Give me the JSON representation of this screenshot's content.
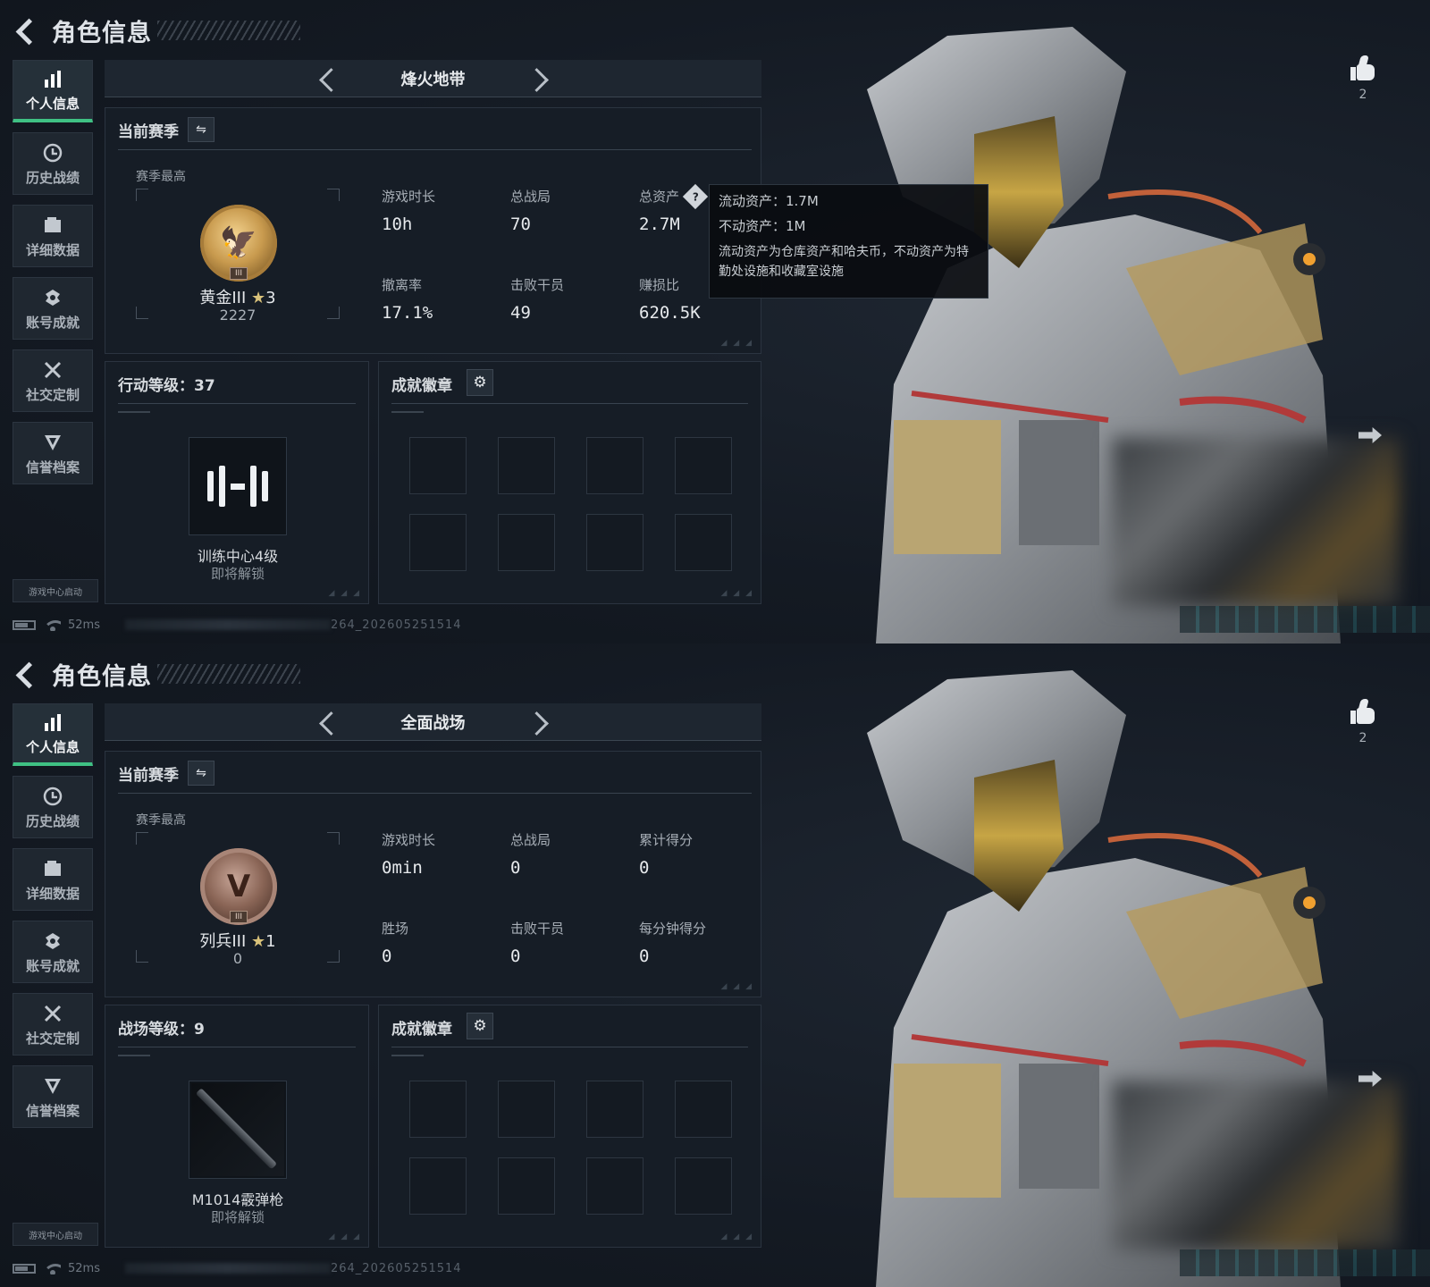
{
  "colors": {
    "accent": "#3fc184",
    "bg": "#141a23",
    "panel": "#161d26",
    "gold": "#c89a4e"
  },
  "screens": [
    {
      "header": {
        "title": "角色信息"
      },
      "sidebar": [
        {
          "label": "个人信息",
          "icon": "bar-chart-icon",
          "active": true
        },
        {
          "label": "历史战绩",
          "icon": "clock-icon"
        },
        {
          "label": "详细数据",
          "icon": "folder-icon"
        },
        {
          "label": "账号成就",
          "icon": "trophy-icon"
        },
        {
          "label": "社交定制",
          "icon": "tools-icon"
        },
        {
          "label": "信誉档案",
          "icon": "shield-icon"
        }
      ],
      "launch": "游戏中心启动",
      "status": {
        "ping": "52ms",
        "build": "264_202605251514"
      },
      "mode": "烽火地带",
      "season": {
        "title": "当前赛季",
        "best_label": "赛季最高",
        "rank_name": "黄金III",
        "rank_stars": "3",
        "rank_score": "2227",
        "badge_tier": "III",
        "stats": [
          {
            "label": "游戏时长",
            "value": "10h"
          },
          {
            "label": "总战局",
            "value": "70"
          },
          {
            "label": "总资产",
            "value": "2.7M"
          },
          {
            "label": "撤离率",
            "value": "17.1%"
          },
          {
            "label": "击败干员",
            "value": "49"
          },
          {
            "label": "赚损比",
            "value": "620.5K"
          }
        ]
      },
      "tooltip": {
        "liquid": "流动资产：1.7M",
        "fixed": "不动资产：1M",
        "desc": "流动资产为仓库资产和哈夫币，不动资产为特勤处设施和收藏室设施"
      },
      "level": {
        "title": "行动等级：37",
        "unlock_name": "训练中心4级",
        "unlock_sub": "即将解锁"
      },
      "achievements": {
        "title": "成就徽章"
      },
      "likes": "2"
    },
    {
      "header": {
        "title": "角色信息"
      },
      "sidebar": [
        {
          "label": "个人信息",
          "icon": "bar-chart-icon",
          "active": true
        },
        {
          "label": "历史战绩",
          "icon": "clock-icon"
        },
        {
          "label": "详细数据",
          "icon": "folder-icon"
        },
        {
          "label": "账号成就",
          "icon": "trophy-icon"
        },
        {
          "label": "社交定制",
          "icon": "tools-icon"
        },
        {
          "label": "信誉档案",
          "icon": "shield-icon"
        }
      ],
      "launch": "游戏中心启动",
      "status": {
        "ping": "52ms",
        "build": "264_202605251514"
      },
      "mode": "全面战场",
      "season": {
        "title": "当前赛季",
        "best_label": "赛季最高",
        "rank_name": "列兵III",
        "rank_stars": "1",
        "rank_score": "0",
        "badge_tier": "III",
        "stats": [
          {
            "label": "游戏时长",
            "value": "0min"
          },
          {
            "label": "总战局",
            "value": "0"
          },
          {
            "label": "累计得分",
            "value": "0"
          },
          {
            "label": "胜场",
            "value": "0"
          },
          {
            "label": "击败干员",
            "value": "0"
          },
          {
            "label": "每分钟得分",
            "value": "0"
          }
        ]
      },
      "level": {
        "title": "战场等级：9",
        "unlock_name": "M1014霰弹枪",
        "unlock_sub": "即将解锁"
      },
      "achievements": {
        "title": "成就徽章"
      },
      "likes": "2"
    }
  ]
}
